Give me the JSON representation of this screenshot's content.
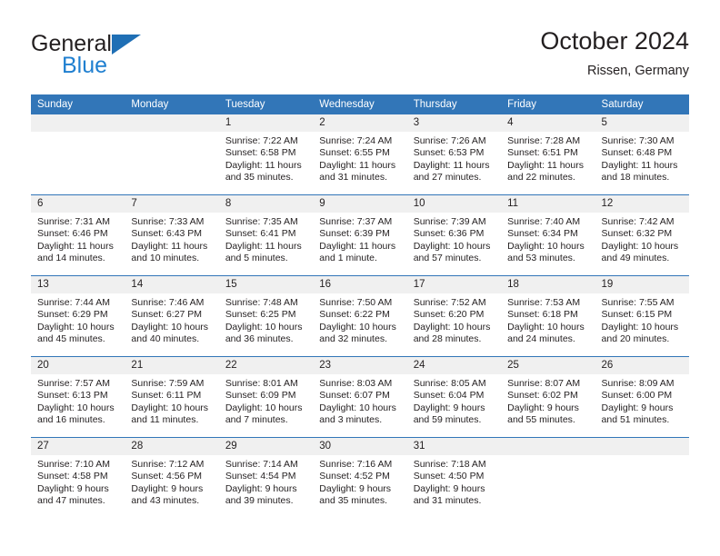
{
  "brand": {
    "name_top": "General",
    "name_bottom": "Blue",
    "triangle_color": "#1f6fb5",
    "blue_color": "#1f7fd0"
  },
  "header": {
    "title": "October 2024",
    "subtitle": "Rissen, Germany"
  },
  "theme": {
    "header_blue": "#3276b8",
    "daynum_background": "#f0f0f0",
    "text_color": "#231f20"
  },
  "weekday_headers": [
    "Sunday",
    "Monday",
    "Tuesday",
    "Wednesday",
    "Thursday",
    "Friday",
    "Saturday"
  ],
  "labels": {
    "sunrise_prefix": "Sunrise:",
    "sunset_prefix": "Sunset:",
    "daylight_prefix": "Daylight:"
  },
  "weeks": [
    [
      {
        "day": "",
        "sunrise": "",
        "sunset": "",
        "daylight": ""
      },
      {
        "day": "",
        "sunrise": "",
        "sunset": "",
        "daylight": ""
      },
      {
        "day": "1",
        "sunrise": "Sunrise: 7:22 AM",
        "sunset": "Sunset: 6:58 PM",
        "daylight": "Daylight: 11 hours and 35 minutes."
      },
      {
        "day": "2",
        "sunrise": "Sunrise: 7:24 AM",
        "sunset": "Sunset: 6:55 PM",
        "daylight": "Daylight: 11 hours and 31 minutes."
      },
      {
        "day": "3",
        "sunrise": "Sunrise: 7:26 AM",
        "sunset": "Sunset: 6:53 PM",
        "daylight": "Daylight: 11 hours and 27 minutes."
      },
      {
        "day": "4",
        "sunrise": "Sunrise: 7:28 AM",
        "sunset": "Sunset: 6:51 PM",
        "daylight": "Daylight: 11 hours and 22 minutes."
      },
      {
        "day": "5",
        "sunrise": "Sunrise: 7:30 AM",
        "sunset": "Sunset: 6:48 PM",
        "daylight": "Daylight: 11 hours and 18 minutes."
      }
    ],
    [
      {
        "day": "6",
        "sunrise": "Sunrise: 7:31 AM",
        "sunset": "Sunset: 6:46 PM",
        "daylight": "Daylight: 11 hours and 14 minutes."
      },
      {
        "day": "7",
        "sunrise": "Sunrise: 7:33 AM",
        "sunset": "Sunset: 6:43 PM",
        "daylight": "Daylight: 11 hours and 10 minutes."
      },
      {
        "day": "8",
        "sunrise": "Sunrise: 7:35 AM",
        "sunset": "Sunset: 6:41 PM",
        "daylight": "Daylight: 11 hours and 5 minutes."
      },
      {
        "day": "9",
        "sunrise": "Sunrise: 7:37 AM",
        "sunset": "Sunset: 6:39 PM",
        "daylight": "Daylight: 11 hours and 1 minute."
      },
      {
        "day": "10",
        "sunrise": "Sunrise: 7:39 AM",
        "sunset": "Sunset: 6:36 PM",
        "daylight": "Daylight: 10 hours and 57 minutes."
      },
      {
        "day": "11",
        "sunrise": "Sunrise: 7:40 AM",
        "sunset": "Sunset: 6:34 PM",
        "daylight": "Daylight: 10 hours and 53 minutes."
      },
      {
        "day": "12",
        "sunrise": "Sunrise: 7:42 AM",
        "sunset": "Sunset: 6:32 PM",
        "daylight": "Daylight: 10 hours and 49 minutes."
      }
    ],
    [
      {
        "day": "13",
        "sunrise": "Sunrise: 7:44 AM",
        "sunset": "Sunset: 6:29 PM",
        "daylight": "Daylight: 10 hours and 45 minutes."
      },
      {
        "day": "14",
        "sunrise": "Sunrise: 7:46 AM",
        "sunset": "Sunset: 6:27 PM",
        "daylight": "Daylight: 10 hours and 40 minutes."
      },
      {
        "day": "15",
        "sunrise": "Sunrise: 7:48 AM",
        "sunset": "Sunset: 6:25 PM",
        "daylight": "Daylight: 10 hours and 36 minutes."
      },
      {
        "day": "16",
        "sunrise": "Sunrise: 7:50 AM",
        "sunset": "Sunset: 6:22 PM",
        "daylight": "Daylight: 10 hours and 32 minutes."
      },
      {
        "day": "17",
        "sunrise": "Sunrise: 7:52 AM",
        "sunset": "Sunset: 6:20 PM",
        "daylight": "Daylight: 10 hours and 28 minutes."
      },
      {
        "day": "18",
        "sunrise": "Sunrise: 7:53 AM",
        "sunset": "Sunset: 6:18 PM",
        "daylight": "Daylight: 10 hours and 24 minutes."
      },
      {
        "day": "19",
        "sunrise": "Sunrise: 7:55 AM",
        "sunset": "Sunset: 6:15 PM",
        "daylight": "Daylight: 10 hours and 20 minutes."
      }
    ],
    [
      {
        "day": "20",
        "sunrise": "Sunrise: 7:57 AM",
        "sunset": "Sunset: 6:13 PM",
        "daylight": "Daylight: 10 hours and 16 minutes."
      },
      {
        "day": "21",
        "sunrise": "Sunrise: 7:59 AM",
        "sunset": "Sunset: 6:11 PM",
        "daylight": "Daylight: 10 hours and 11 minutes."
      },
      {
        "day": "22",
        "sunrise": "Sunrise: 8:01 AM",
        "sunset": "Sunset: 6:09 PM",
        "daylight": "Daylight: 10 hours and 7 minutes."
      },
      {
        "day": "23",
        "sunrise": "Sunrise: 8:03 AM",
        "sunset": "Sunset: 6:07 PM",
        "daylight": "Daylight: 10 hours and 3 minutes."
      },
      {
        "day": "24",
        "sunrise": "Sunrise: 8:05 AM",
        "sunset": "Sunset: 6:04 PM",
        "daylight": "Daylight: 9 hours and 59 minutes."
      },
      {
        "day": "25",
        "sunrise": "Sunrise: 8:07 AM",
        "sunset": "Sunset: 6:02 PM",
        "daylight": "Daylight: 9 hours and 55 minutes."
      },
      {
        "day": "26",
        "sunrise": "Sunrise: 8:09 AM",
        "sunset": "Sunset: 6:00 PM",
        "daylight": "Daylight: 9 hours and 51 minutes."
      }
    ],
    [
      {
        "day": "27",
        "sunrise": "Sunrise: 7:10 AM",
        "sunset": "Sunset: 4:58 PM",
        "daylight": "Daylight: 9 hours and 47 minutes."
      },
      {
        "day": "28",
        "sunrise": "Sunrise: 7:12 AM",
        "sunset": "Sunset: 4:56 PM",
        "daylight": "Daylight: 9 hours and 43 minutes."
      },
      {
        "day": "29",
        "sunrise": "Sunrise: 7:14 AM",
        "sunset": "Sunset: 4:54 PM",
        "daylight": "Daylight: 9 hours and 39 minutes."
      },
      {
        "day": "30",
        "sunrise": "Sunrise: 7:16 AM",
        "sunset": "Sunset: 4:52 PM",
        "daylight": "Daylight: 9 hours and 35 minutes."
      },
      {
        "day": "31",
        "sunrise": "Sunrise: 7:18 AM",
        "sunset": "Sunset: 4:50 PM",
        "daylight": "Daylight: 9 hours and 31 minutes."
      },
      {
        "day": "",
        "sunrise": "",
        "sunset": "",
        "daylight": ""
      },
      {
        "day": "",
        "sunrise": "",
        "sunset": "",
        "daylight": ""
      }
    ]
  ]
}
